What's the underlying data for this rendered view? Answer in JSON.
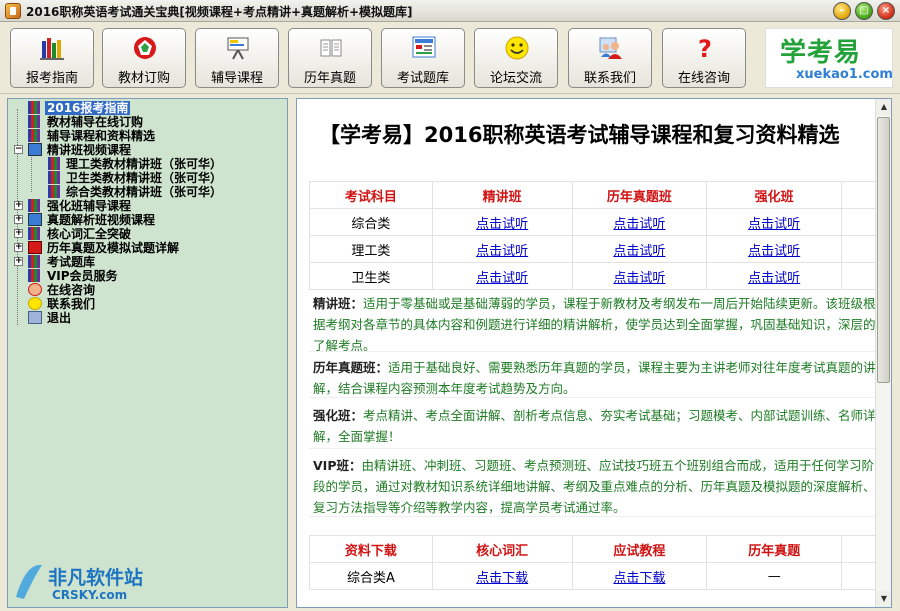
{
  "window": {
    "title": "2016职称英语考试通关宝典[视频课程+考点精讲+真题解析+模拟题库]"
  },
  "toolbar": {
    "buttons": [
      {
        "label": "报考指南",
        "icon": "books-icon"
      },
      {
        "label": "教材订购",
        "icon": "target-icon"
      },
      {
        "label": "辅导课程",
        "icon": "projector-icon"
      },
      {
        "label": "历年真题",
        "icon": "document-icon"
      },
      {
        "label": "考试题库",
        "icon": "question-bank-icon"
      },
      {
        "label": "论坛交流",
        "icon": "smiley-icon"
      },
      {
        "label": "联系我们",
        "icon": "people-icon"
      },
      {
        "label": "在线咨询",
        "icon": "question-mark-icon"
      }
    ],
    "logo": {
      "cn": "学考易",
      "en": "xuekao1.com"
    }
  },
  "tree": {
    "items": [
      {
        "label": "2016报考指南",
        "selected": true
      },
      {
        "label": "教材辅导在线订购"
      },
      {
        "label": "辅导课程和资料精选"
      },
      {
        "label": "精讲班视频课程",
        "expanded": true
      },
      {
        "label": "理工类教材精讲班（张可华）"
      },
      {
        "label": "卫生类教材精讲班（张可华）"
      },
      {
        "label": "综合类教材精讲班（张可华）"
      },
      {
        "label": "强化班辅导课程"
      },
      {
        "label": "真题解析班视频课程"
      },
      {
        "label": "核心词汇全突破"
      },
      {
        "label": "历年真题及模拟试题详解"
      },
      {
        "label": "考试题库"
      },
      {
        "label": "VIP会员服务"
      },
      {
        "label": "在线咨询"
      },
      {
        "label": "联系我们"
      },
      {
        "label": "退出"
      }
    ]
  },
  "content": {
    "title": "【学考易】2016职称英语考试辅导课程和复习资料精选",
    "table1": {
      "headers": [
        "考试科目",
        "精讲班",
        "历年真题班",
        "强化班",
        ""
      ],
      "rows": [
        [
          "综合类",
          "点击试听",
          "点击试听",
          "点击试听",
          ""
        ],
        [
          "理工类",
          "点击试听",
          "点击试听",
          "点击试听",
          ""
        ],
        [
          "卫生类",
          "点击试听",
          "点击试听",
          "点击试听",
          ""
        ]
      ]
    },
    "descriptions": [
      {
        "name": "精讲班：",
        "text": "适用于零基础或是基础薄弱的学员，课程于新教材及考纲发布一周后开始陆续更新。该班级根据考纲对各章节的具体内容和例题进行详细的精讲解析，使学员达到全面掌握，巩固基础知识，深层的了解考点。"
      },
      {
        "name": "历年真题班：",
        "text": "适用于基础良好、需要熟悉历年真题的学员，课程主要为主讲老师对往年度考试真题的讲解，结合课程内容预测本年度考试趋势及方向。"
      },
      {
        "name": "强化班：",
        "text": "考点精讲、考点全面讲解、剖析考点信息、夯实考试基础；习题模考、内部试题训练、名师详解，全面掌握！"
      },
      {
        "name": "VIP班：",
        "text": "由精讲班、冲刺班、习题班、考点预测班、应试技巧班五个班别组合而成，适用于任何学习阶段的学员，通过对教材知识系统详细地讲解、考纲及重点难点的分析、历年真题及模拟题的深度解析、复习方法指导等介绍等教学内容，提高学员考试通过率。"
      }
    ],
    "table2": {
      "headers": [
        "资料下载",
        "核心词汇",
        "应试教程",
        "历年真题",
        ""
      ],
      "rows": [
        [
          "综合类A",
          "点击下载",
          "点击下载",
          "—",
          ""
        ]
      ]
    }
  },
  "watermark": {
    "cn": "非凡软件站",
    "en": "CRSKY.com"
  },
  "colors": {
    "tree_bg": "#cfe4cf",
    "header_red": "#d01414",
    "desc_green": "#1e7b24",
    "link_blue": "#0000cc"
  }
}
